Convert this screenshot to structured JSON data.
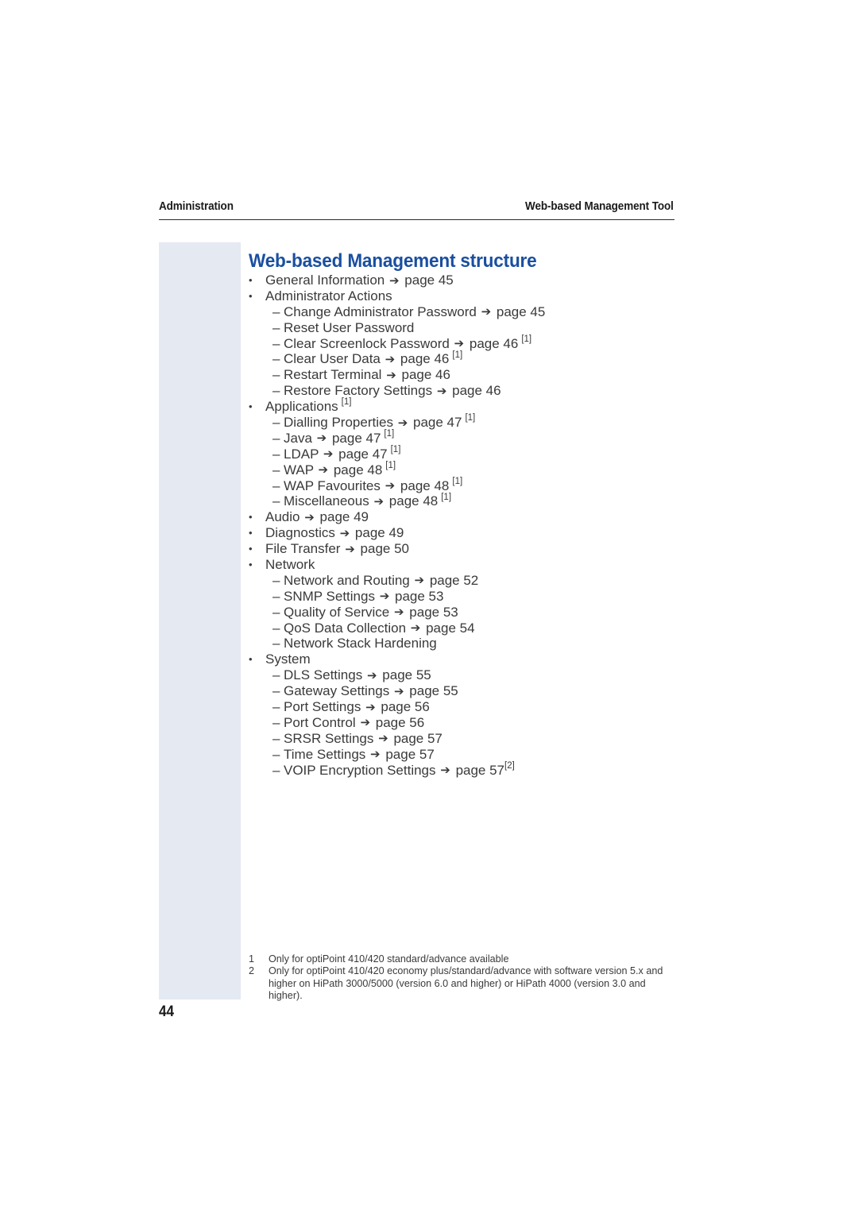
{
  "header": {
    "left": "Administration",
    "right": "Web-based Management Tool"
  },
  "heading": "Web-based Management structure",
  "arrow_glyph": "➔",
  "bullet_glyph": "•",
  "dash_glyph": "–",
  "colors": {
    "heading": "#1a4fa0",
    "side_band": "#e4e9f2",
    "body_text": "#3a3a3a",
    "rule": "#2b2b2b"
  },
  "items": [
    {
      "level": 1,
      "label": "General Information",
      "page": "page 45"
    },
    {
      "level": 1,
      "label": "Administrator Actions"
    },
    {
      "level": 2,
      "label": "Change Administrator Password",
      "page": "page 45"
    },
    {
      "level": 2,
      "label": "Reset User Password"
    },
    {
      "level": 2,
      "label": "Clear Screenlock Password",
      "page": "page 46",
      "ref": "[1]",
      "ref_spaced": true
    },
    {
      "level": 2,
      "label": "Clear User Data",
      "page": "page 46",
      "ref": "[1]",
      "ref_spaced": true
    },
    {
      "level": 2,
      "label": "Restart Terminal",
      "page": "page 46"
    },
    {
      "level": 2,
      "label": "Restore Factory Settings",
      "page": "page 46"
    },
    {
      "level": 1,
      "label": "Applications",
      "ref": "[1]",
      "ref_spaced": true
    },
    {
      "level": 2,
      "label": "Dialling Properties",
      "page": "page 47",
      "ref": "[1]",
      "ref_spaced": true
    },
    {
      "level": 2,
      "label": "Java",
      "page": "page 47",
      "ref": "[1]",
      "ref_spaced": true
    },
    {
      "level": 2,
      "label": "LDAP",
      "page": "page 47",
      "ref": "[1]",
      "ref_spaced": true
    },
    {
      "level": 2,
      "label": "WAP",
      "page": "page 48",
      "ref": "[1]",
      "ref_spaced": true
    },
    {
      "level": 2,
      "label": "WAP Favourites",
      "page": "page 48",
      "ref": "[1]",
      "ref_spaced": true
    },
    {
      "level": 2,
      "label": "Miscellaneous",
      "page": "page 48",
      "ref": "[1]",
      "ref_spaced": true
    },
    {
      "level": 1,
      "label": "Audio",
      "page": "page 49"
    },
    {
      "level": 1,
      "label": "Diagnostics",
      "page": "page 49"
    },
    {
      "level": 1,
      "label": "File Transfer",
      "page": "page 50"
    },
    {
      "level": 1,
      "label": "Network"
    },
    {
      "level": 2,
      "label": "Network and Routing",
      "page": "page 52"
    },
    {
      "level": 2,
      "label": "SNMP Settings",
      "page": "page 53"
    },
    {
      "level": 2,
      "label": "Quality of Service",
      "page": "page 53"
    },
    {
      "level": 2,
      "label": "QoS Data Collection",
      "page": "page 54"
    },
    {
      "level": 2,
      "label": "Network Stack Hardening"
    },
    {
      "level": 1,
      "label": "System"
    },
    {
      "level": 2,
      "label": "DLS Settings",
      "page": "page 55"
    },
    {
      "level": 2,
      "label": "Gateway Settings",
      "page": "page 55"
    },
    {
      "level": 2,
      "label": "Port Settings",
      "page": "page 56"
    },
    {
      "level": 2,
      "label": "Port Control",
      "page": "page 56"
    },
    {
      "level": 2,
      "label": "SRSR Settings",
      "page": "page 57"
    },
    {
      "level": 2,
      "label": "Time Settings",
      "page": "page 57"
    },
    {
      "level": 2,
      "label": "VOIP Encryption Settings",
      "page": "page 57",
      "ref": "[2]",
      "ref_spaced": false
    }
  ],
  "footnotes": [
    {
      "num": "1",
      "text": "Only for optiPoint 410/420 standard/advance available"
    },
    {
      "num": "2",
      "text": "Only for optiPoint 410/420 economy plus/standard/advance with software version 5.x and higher on HiPath 3000/5000 (version 6.0 and higher) or HiPath 4000 (version 3.0 and higher)."
    }
  ],
  "folio": "44"
}
